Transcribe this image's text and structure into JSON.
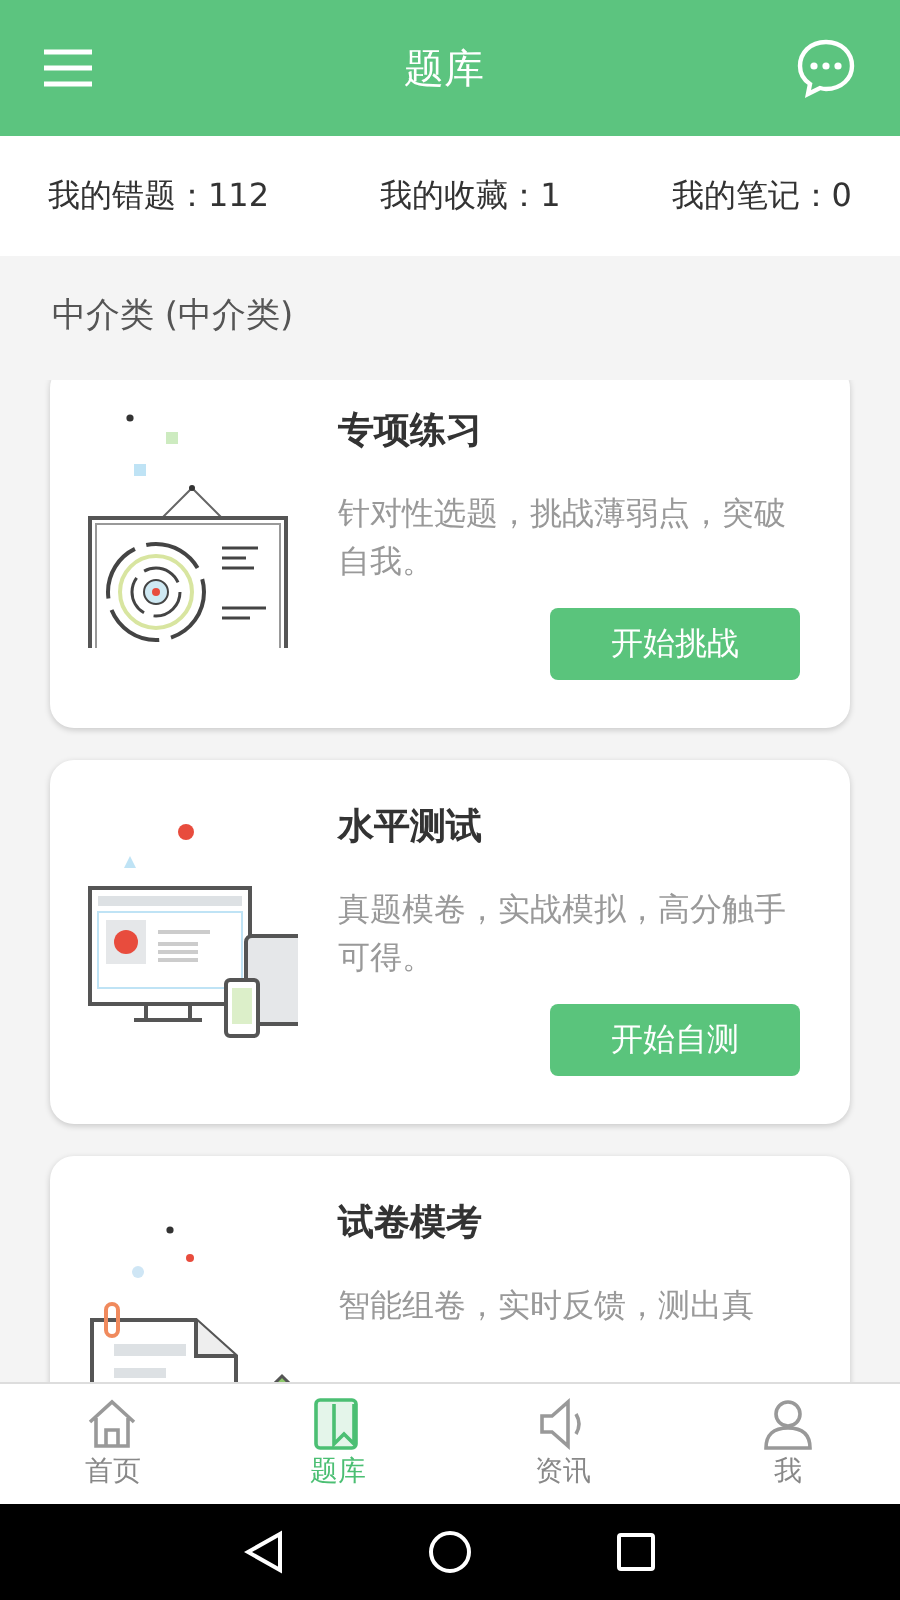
{
  "header": {
    "title": "题库"
  },
  "stats": [
    {
      "label": "我的错题：112"
    },
    {
      "label": "我的收藏：1"
    },
    {
      "label": "我的笔记：0"
    }
  ],
  "section": {
    "title": "中介类 (中介类)"
  },
  "cards": [
    {
      "kind": "practice",
      "title": "专项练习",
      "description": "针对性选题，挑战薄弱点，突破自我。",
      "button": "开始挑战"
    },
    {
      "kind": "test",
      "title": "水平测试",
      "description": "真题模卷，实战模拟，高分触手可得。",
      "button": "开始自测"
    },
    {
      "kind": "exam",
      "title": "试卷模考",
      "description": "智能组卷，实时反馈，测出真"
    }
  ],
  "tabs": [
    {
      "kind": "home",
      "label": "首页",
      "selected": false
    },
    {
      "kind": "bank",
      "label": "题库",
      "selected": true
    },
    {
      "kind": "news",
      "label": "资讯",
      "selected": false
    },
    {
      "kind": "profile",
      "label": "我",
      "selected": false
    }
  ]
}
